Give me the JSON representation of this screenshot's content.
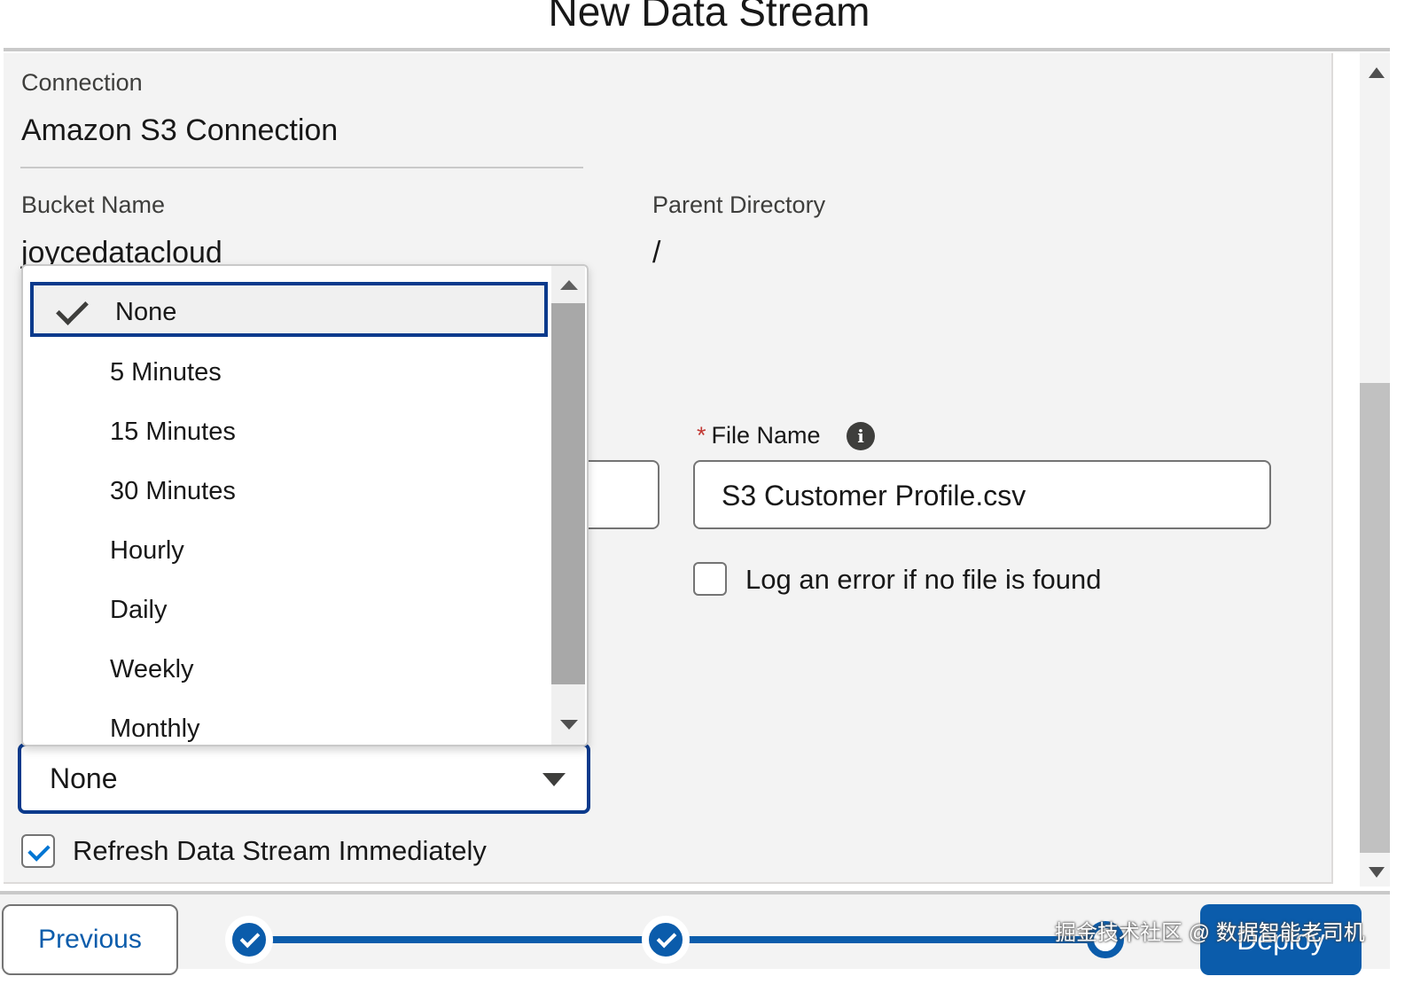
{
  "modal": {
    "title": "New Data Stream"
  },
  "connection": {
    "label": "Connection",
    "value": "Amazon S3 Connection"
  },
  "bucket": {
    "label": "Bucket Name",
    "value": "joycedatacloud"
  },
  "parent_directory": {
    "label": "Parent Directory",
    "value": "/"
  },
  "file_name": {
    "required_marker": "*",
    "label": "File Name",
    "value": "S3 Customer Profile.csv",
    "info_icon": "info-icon"
  },
  "log_error": {
    "label": "Log an error if no file is found",
    "checked": false
  },
  "refresh_schedule": {
    "selected": "None",
    "options": [
      "None",
      "5 Minutes",
      "15 Minutes",
      "30 Minutes",
      "Hourly",
      "Daily",
      "Weekly",
      "Monthly"
    ]
  },
  "refresh_immediately": {
    "label": "Refresh Data Stream Immediately",
    "checked": true
  },
  "footer": {
    "previous_label": "Previous",
    "deploy_label": "Deploy",
    "steps_completed": 2,
    "steps_total": 3
  },
  "watermark": "掘金技术社区 @ 数据智能老司机",
  "colors": {
    "brand": "#0b5cab",
    "focus_border": "#0b3a8c",
    "required": "#c23934"
  }
}
